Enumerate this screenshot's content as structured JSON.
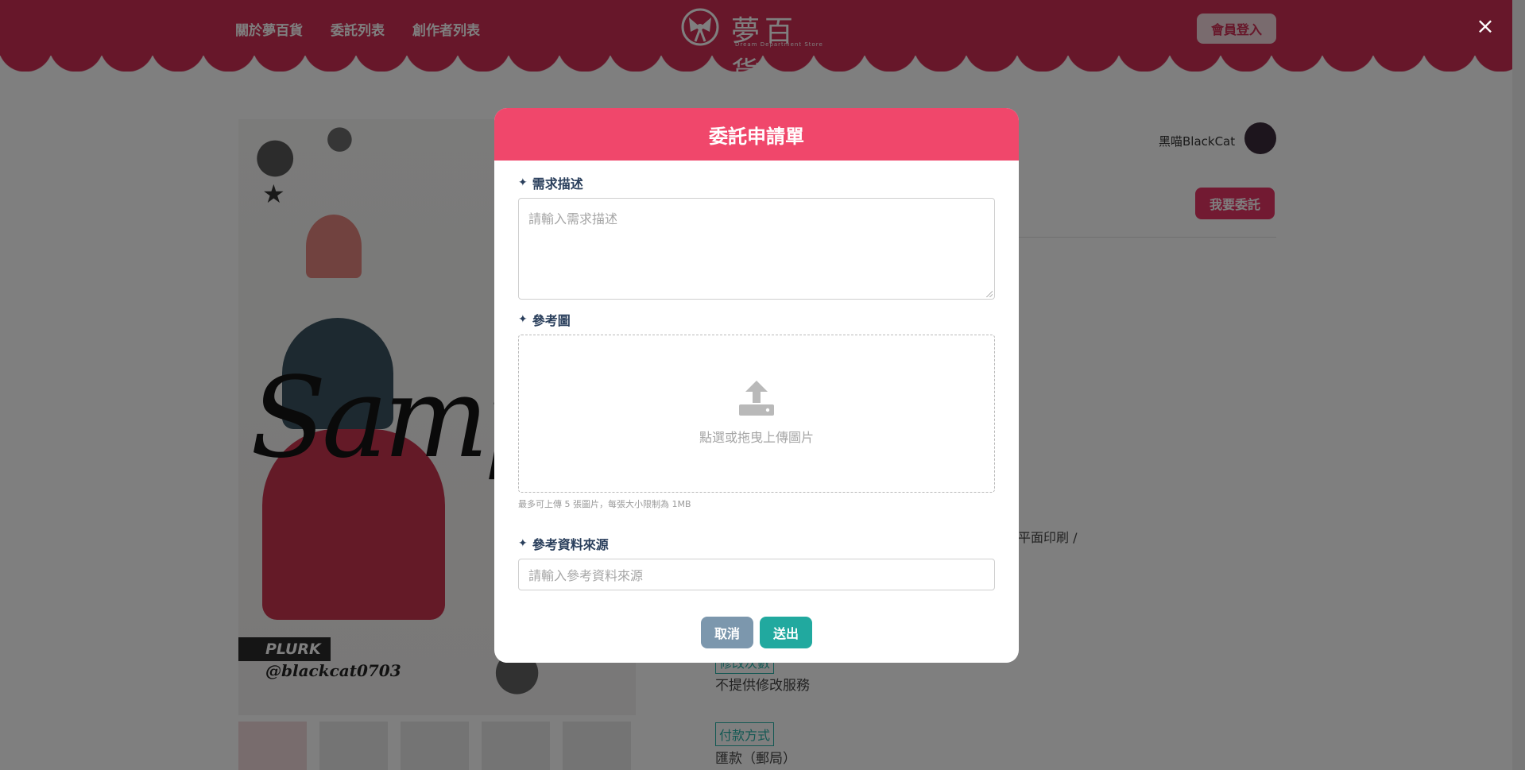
{
  "header": {
    "nav": [
      "關於夢百貨",
      "委託列表",
      "創作者列表"
    ],
    "logo_text": "夢百貨",
    "logo_sub": "Dream Department Store",
    "login_label": "會員登入"
  },
  "page": {
    "artwork": {
      "sample_text": "Samp",
      "plurk_label": "PLURK",
      "handle": "@blackcat0703"
    },
    "artist_name": "黑喵BlackCat",
    "commission_button": "我要委託",
    "partial_text": "可平面印刷 /",
    "revision_tag": "修改次數",
    "revision_text": "不提供修改服務",
    "payment_tag": "付款方式",
    "payment_text": "匯款（郵局）"
  },
  "modal": {
    "title": "委託申請單",
    "description_label": "需求描述",
    "description_placeholder": "請輸入需求描述",
    "reference_label": "參考圖",
    "upload_text": "點選或拖曳上傳圖片",
    "upload_hint": "最多可上傳 5 張圖片，每張大小限制為 1MB",
    "source_label": "參考資料來源",
    "source_placeholder": "請輸入參考資料來源",
    "cancel_label": "取消",
    "submit_label": "送出"
  },
  "colors": {
    "brand": "#cf2f55",
    "modal_header": "#f0476b",
    "submit": "#21a99f",
    "cancel": "#7c97ad"
  }
}
